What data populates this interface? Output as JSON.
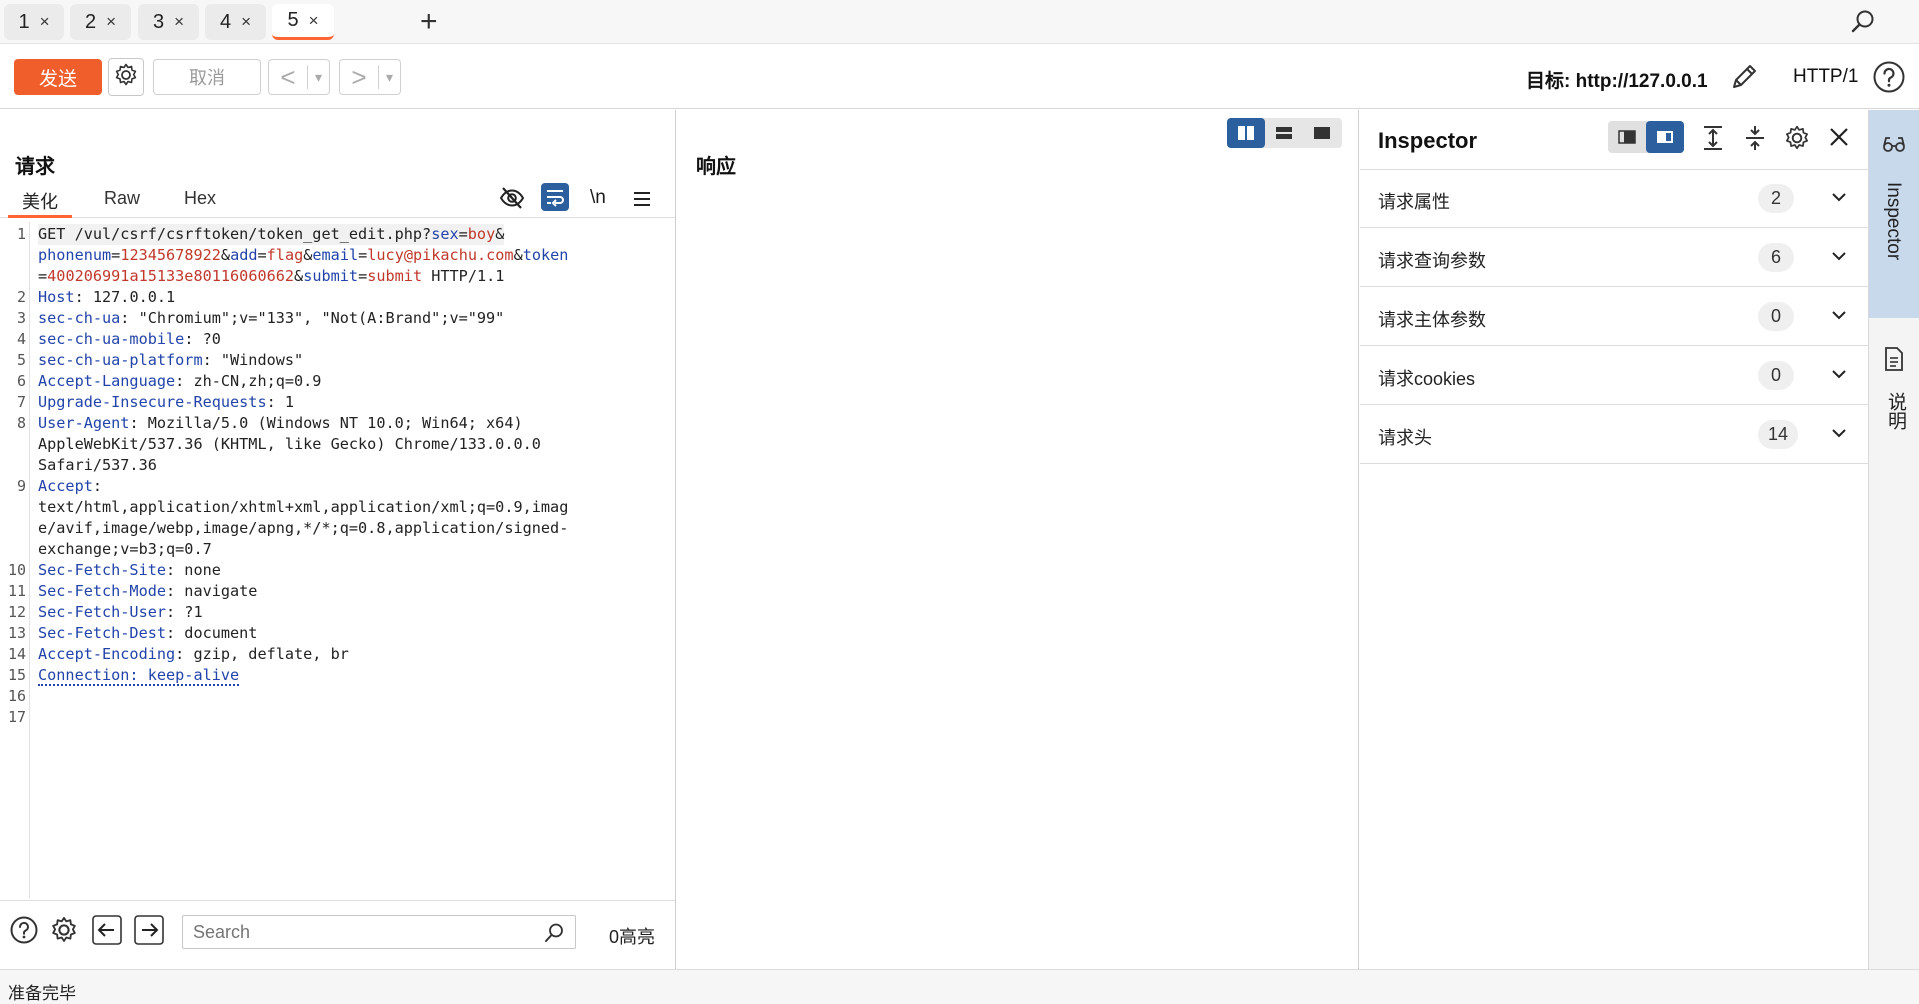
{
  "tabs": [
    {
      "label": "1",
      "close": "×"
    },
    {
      "label": "2",
      "close": "×"
    },
    {
      "label": "3",
      "close": "×"
    },
    {
      "label": "4",
      "close": "×"
    },
    {
      "label": "5",
      "close": "×",
      "active": true
    }
  ],
  "tab_add": "+",
  "toolbar": {
    "send_label": "发送",
    "cancel_label": "取消",
    "back_arrow": "<",
    "forward_arrow": ">",
    "dropdown_glyph": "▾",
    "target_label": "目标: http://127.0.0.1",
    "http_version": "HTTP/1"
  },
  "request": {
    "title": "请求",
    "tabs": [
      "美化",
      "Raw",
      "Hex"
    ],
    "newline_label": "\\n",
    "lines": [
      {
        "n": "1",
        "segments": [
          {
            "t": "GET /vul/csrf/csrftoken/token_get_edit.php?",
            "c": "p"
          },
          {
            "t": "sex",
            "c": "k"
          },
          {
            "t": "=",
            "c": "p"
          },
          {
            "t": "boy",
            "c": "v"
          },
          {
            "t": "&",
            "c": "p"
          }
        ]
      },
      {
        "n": "",
        "segments": [
          {
            "t": "phonenum",
            "c": "k"
          },
          {
            "t": "=",
            "c": "p"
          },
          {
            "t": "12345678922",
            "c": "v"
          },
          {
            "t": "&",
            "c": "p"
          },
          {
            "t": "add",
            "c": "k"
          },
          {
            "t": "=",
            "c": "p"
          },
          {
            "t": "flag",
            "c": "v"
          },
          {
            "t": "&",
            "c": "p"
          },
          {
            "t": "email",
            "c": "k"
          },
          {
            "t": "=",
            "c": "p"
          },
          {
            "t": "lucy@pikachu.com",
            "c": "v"
          },
          {
            "t": "&",
            "c": "p"
          },
          {
            "t": "token",
            "c": "k"
          }
        ]
      },
      {
        "n": "",
        "segments": [
          {
            "t": "=",
            "c": "p"
          },
          {
            "t": "400206991a15133e80116060662",
            "c": "v"
          },
          {
            "t": "&",
            "c": "p"
          },
          {
            "t": "submit",
            "c": "k"
          },
          {
            "t": "=",
            "c": "p"
          },
          {
            "t": "submit",
            "c": "v"
          },
          {
            "t": " HTTP/1.1",
            "c": "p"
          }
        ]
      },
      {
        "n": "2",
        "segments": [
          {
            "t": "Host",
            "c": "k"
          },
          {
            "t": ": 127.0.0.1",
            "c": "p"
          }
        ]
      },
      {
        "n": "3",
        "segments": [
          {
            "t": "sec-ch-ua",
            "c": "k"
          },
          {
            "t": ": \"Chromium\";v=\"133\", \"Not(A:Brand\";v=\"99\"",
            "c": "p"
          }
        ]
      },
      {
        "n": "4",
        "segments": [
          {
            "t": "sec-ch-ua-mobile",
            "c": "k"
          },
          {
            "t": ": ?0",
            "c": "p"
          }
        ]
      },
      {
        "n": "5",
        "segments": [
          {
            "t": "sec-ch-ua-platform",
            "c": "k"
          },
          {
            "t": ": \"Windows\"",
            "c": "p"
          }
        ]
      },
      {
        "n": "6",
        "segments": [
          {
            "t": "Accept-Language",
            "c": "k"
          },
          {
            "t": ": zh-CN,zh;q=0.9",
            "c": "p"
          }
        ]
      },
      {
        "n": "7",
        "segments": [
          {
            "t": "Upgrade-Insecure-Requests",
            "c": "k"
          },
          {
            "t": ": 1",
            "c": "p"
          }
        ]
      },
      {
        "n": "8",
        "segments": [
          {
            "t": "User-Agent",
            "c": "k"
          },
          {
            "t": ": Mozilla/5.0 (Windows NT 10.0; Win64; x64)",
            "c": "p"
          }
        ]
      },
      {
        "n": "",
        "segments": [
          {
            "t": "AppleWebKit/537.36 (KHTML, like Gecko) Chrome/133.0.0.0",
            "c": "p"
          }
        ]
      },
      {
        "n": "",
        "segments": [
          {
            "t": "Safari/537.36",
            "c": "p"
          }
        ]
      },
      {
        "n": "9",
        "segments": [
          {
            "t": "Accept",
            "c": "k"
          },
          {
            "t": ":",
            "c": "p"
          }
        ]
      },
      {
        "n": "",
        "segments": [
          {
            "t": "text/html,application/xhtml+xml,application/xml;q=0.9,imag",
            "c": "p"
          }
        ]
      },
      {
        "n": "",
        "segments": [
          {
            "t": "e/avif,image/webp,image/apng,*/*;q=0.8,application/signed-",
            "c": "p"
          }
        ]
      },
      {
        "n": "",
        "segments": [
          {
            "t": "exchange;v=b3;q=0.7",
            "c": "p"
          }
        ]
      },
      {
        "n": "10",
        "segments": [
          {
            "t": "Sec-Fetch-Site",
            "c": "k"
          },
          {
            "t": ": none",
            "c": "p"
          }
        ]
      },
      {
        "n": "11",
        "segments": [
          {
            "t": "Sec-Fetch-Mode",
            "c": "k"
          },
          {
            "t": ": navigate",
            "c": "p"
          }
        ]
      },
      {
        "n": "12",
        "segments": [
          {
            "t": "Sec-Fetch-User",
            "c": "k"
          },
          {
            "t": ": ?1",
            "c": "p"
          }
        ]
      },
      {
        "n": "13",
        "segments": [
          {
            "t": "Sec-Fetch-Dest",
            "c": "k"
          },
          {
            "t": ": document",
            "c": "p"
          }
        ]
      },
      {
        "n": "14",
        "segments": [
          {
            "t": "Accept-Encoding",
            "c": "k"
          },
          {
            "t": ": gzip, deflate, br",
            "c": "p"
          }
        ]
      },
      {
        "n": "15",
        "segments": [
          {
            "t": "Connection: keep-alive",
            "c": "k dotted"
          }
        ]
      },
      {
        "n": "16",
        "segments": []
      },
      {
        "n": "17",
        "segments": []
      }
    ],
    "search_placeholder": "Search",
    "highlight_count": "0高亮"
  },
  "response": {
    "title": "响应"
  },
  "inspector": {
    "title": "Inspector",
    "sections": [
      {
        "label": "请求属性",
        "count": "2"
      },
      {
        "label": "请求查询参数",
        "count": "6"
      },
      {
        "label": "请求主体参数",
        "count": "0"
      },
      {
        "label": "请求cookies",
        "count": "0"
      },
      {
        "label": "请求头",
        "count": "14"
      }
    ]
  },
  "side_rail": {
    "items": [
      {
        "label": "Inspector",
        "icon": "inspector-glasses-icon",
        "active": true
      },
      {
        "label": "说明",
        "icon": "document-icon",
        "active": false
      }
    ]
  },
  "status": {
    "text": "准备完毕"
  },
  "colors": {
    "accent": "#ff6633",
    "send_button": "#f05e2c",
    "toggle_active": "#2c5f9e",
    "header_key": "#2244aa",
    "param_value": "#c0392b",
    "rail_active": "#c9d9ec"
  }
}
